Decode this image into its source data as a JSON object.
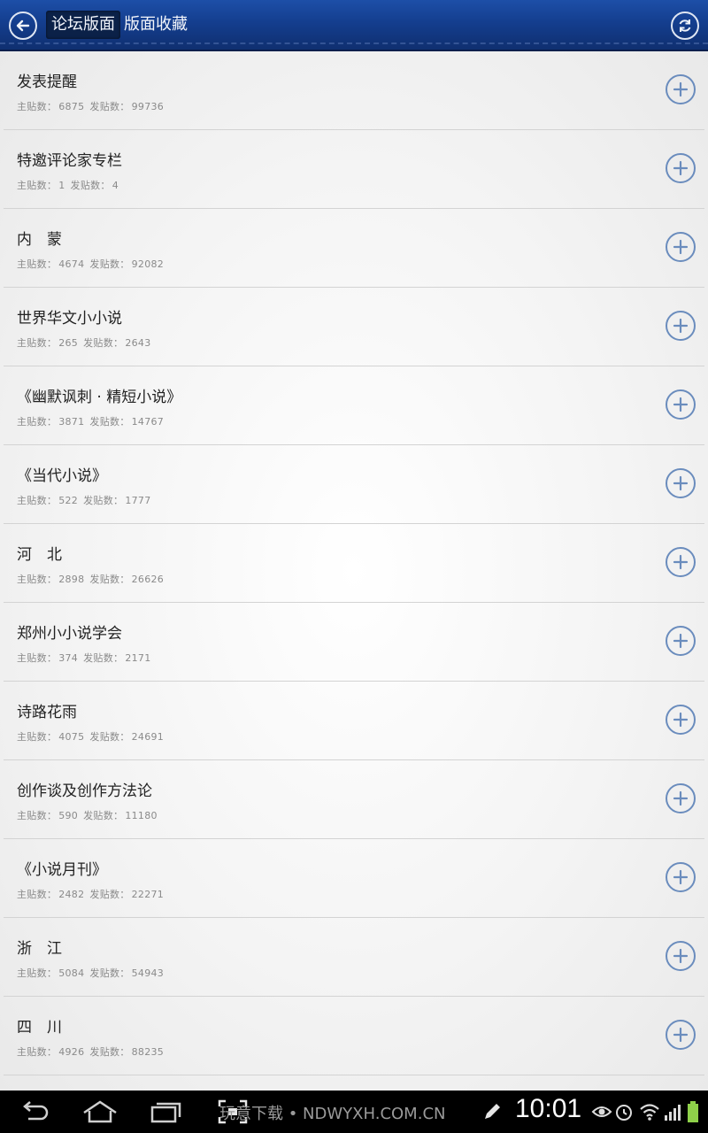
{
  "header": {
    "tabs": [
      {
        "label": "论坛版面",
        "active": true
      },
      {
        "label": "版面收藏",
        "active": false
      }
    ],
    "back_icon": "back-arrow-icon",
    "refresh_icon": "refresh-icon",
    "colors": {
      "bar": "#143e8e",
      "active_tab": "#0b2148"
    }
  },
  "list": {
    "stat_labels": {
      "topics": "主贴数：",
      "posts": "发贴数："
    },
    "items": [
      {
        "title": "发表提醒",
        "topics": "6875",
        "posts": "99736"
      },
      {
        "title": "特邀评论家专栏",
        "topics": "1",
        "posts": "4"
      },
      {
        "title": "内　蒙",
        "topics": "4674",
        "posts": "92082"
      },
      {
        "title": "世界华文小小说",
        "topics": "265",
        "posts": "2643"
      },
      {
        "title": "《幽默讽刺 · 精短小说》",
        "topics": "3871",
        "posts": "14767"
      },
      {
        "title": "《当代小说》",
        "topics": "522",
        "posts": "1777"
      },
      {
        "title": "河　北",
        "topics": "2898",
        "posts": "26626"
      },
      {
        "title": "郑州小小说学会",
        "topics": "374",
        "posts": "2171"
      },
      {
        "title": "诗路花雨",
        "topics": "4075",
        "posts": "24691"
      },
      {
        "title": "创作谈及创作方法论",
        "topics": "590",
        "posts": "11180"
      },
      {
        "title": "《小说月刊》",
        "topics": "2482",
        "posts": "22271"
      },
      {
        "title": "浙　江",
        "topics": "5084",
        "posts": "54943"
      },
      {
        "title": "四　川",
        "topics": "4926",
        "posts": "88235"
      }
    ],
    "add_icon": "plus-circle-icon",
    "accent": "#6a8cbd"
  },
  "navbar": {
    "watermark": "玩意下载 • NDWYXH.COM.CN",
    "time": "10:01"
  }
}
